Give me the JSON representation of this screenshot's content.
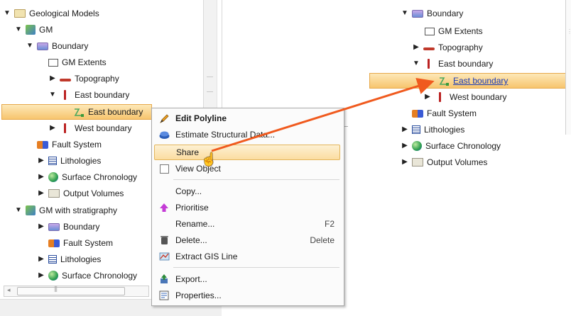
{
  "left_tree": [
    {
      "label": "Geological Models",
      "icon": "folder-icon",
      "expanded": true
    },
    {
      "label": "GM",
      "icon": "geological-model-icon",
      "expanded": true
    },
    {
      "label": "Boundary",
      "icon": "boundary-icon",
      "expanded": true
    },
    {
      "label": "GM Extents",
      "icon": "extents-icon"
    },
    {
      "label": "Topography",
      "icon": "topography-icon",
      "expanded": false
    },
    {
      "label": "East boundary",
      "icon": "polyline-icon",
      "expanded": true
    },
    {
      "label": "East boundary",
      "icon": "line-icon",
      "selected": true
    },
    {
      "label": "West boundary",
      "icon": "polyline-icon",
      "expanded": false
    },
    {
      "label": "Fault System",
      "icon": "fault-system-icon"
    },
    {
      "label": "Lithologies",
      "icon": "lithologies-icon",
      "expanded": false
    },
    {
      "label": "Surface Chronology",
      "icon": "chronology-icon",
      "expanded": false
    },
    {
      "label": "Output Volumes",
      "icon": "output-volumes-icon",
      "expanded": false
    },
    {
      "label": "GM with stratigraphy",
      "icon": "geological-model-icon",
      "expanded": true
    },
    {
      "label": "Boundary",
      "icon": "boundary-icon",
      "expanded": false
    },
    {
      "label": "Fault System",
      "icon": "fault-system-icon"
    },
    {
      "label": "Lithologies",
      "icon": "lithologies-icon",
      "expanded": false
    },
    {
      "label": "Surface Chronology",
      "icon": "chronology-icon",
      "expanded": false
    }
  ],
  "context_menu": [
    {
      "label": "Edit Polyline",
      "icon": "pencil-icon",
      "bold": true
    },
    {
      "label": "Estimate Structural Data...",
      "icon": "structural-data-icon"
    },
    {
      "label": "Share",
      "icon": "",
      "hover": true
    },
    {
      "label": "View Object",
      "icon": "checkbox-icon"
    },
    {
      "label": "Copy...",
      "icon": ""
    },
    {
      "label": "Prioritise",
      "icon": "prioritise-icon"
    },
    {
      "label": "Rename...",
      "icon": "",
      "shortcut": "F2"
    },
    {
      "label": "Delete...",
      "icon": "trash-icon",
      "shortcut": "Delete"
    },
    {
      "label": "Extract GIS Line",
      "icon": "gis-line-icon"
    },
    {
      "label": "Export...",
      "icon": "export-icon"
    },
    {
      "label": "Properties...",
      "icon": "properties-icon"
    }
  ],
  "right_tree": [
    {
      "label": "Boundary",
      "icon": "boundary-icon",
      "expanded": true
    },
    {
      "label": "GM Extents",
      "icon": "extents-icon"
    },
    {
      "label": "Topography",
      "icon": "topography-icon",
      "expanded": false
    },
    {
      "label": "East boundary",
      "icon": "polyline-icon",
      "expanded": true
    },
    {
      "label": "East boundary",
      "icon": "line-icon",
      "selected": true,
      "link": true
    },
    {
      "label": "West boundary",
      "icon": "polyline-icon",
      "expanded": false
    },
    {
      "label": "Fault System",
      "icon": "fault-system-icon"
    },
    {
      "label": "Lithologies",
      "icon": "lithologies-icon",
      "expanded": false
    },
    {
      "label": "Surface Chronology",
      "icon": "chronology-icon",
      "expanded": false
    },
    {
      "label": "Output Volumes",
      "icon": "output-volumes-icon",
      "expanded": false
    }
  ],
  "colors": {
    "selection": "#f7c56e",
    "arrow": "#f05a1e",
    "link": "#1a3bb8"
  }
}
